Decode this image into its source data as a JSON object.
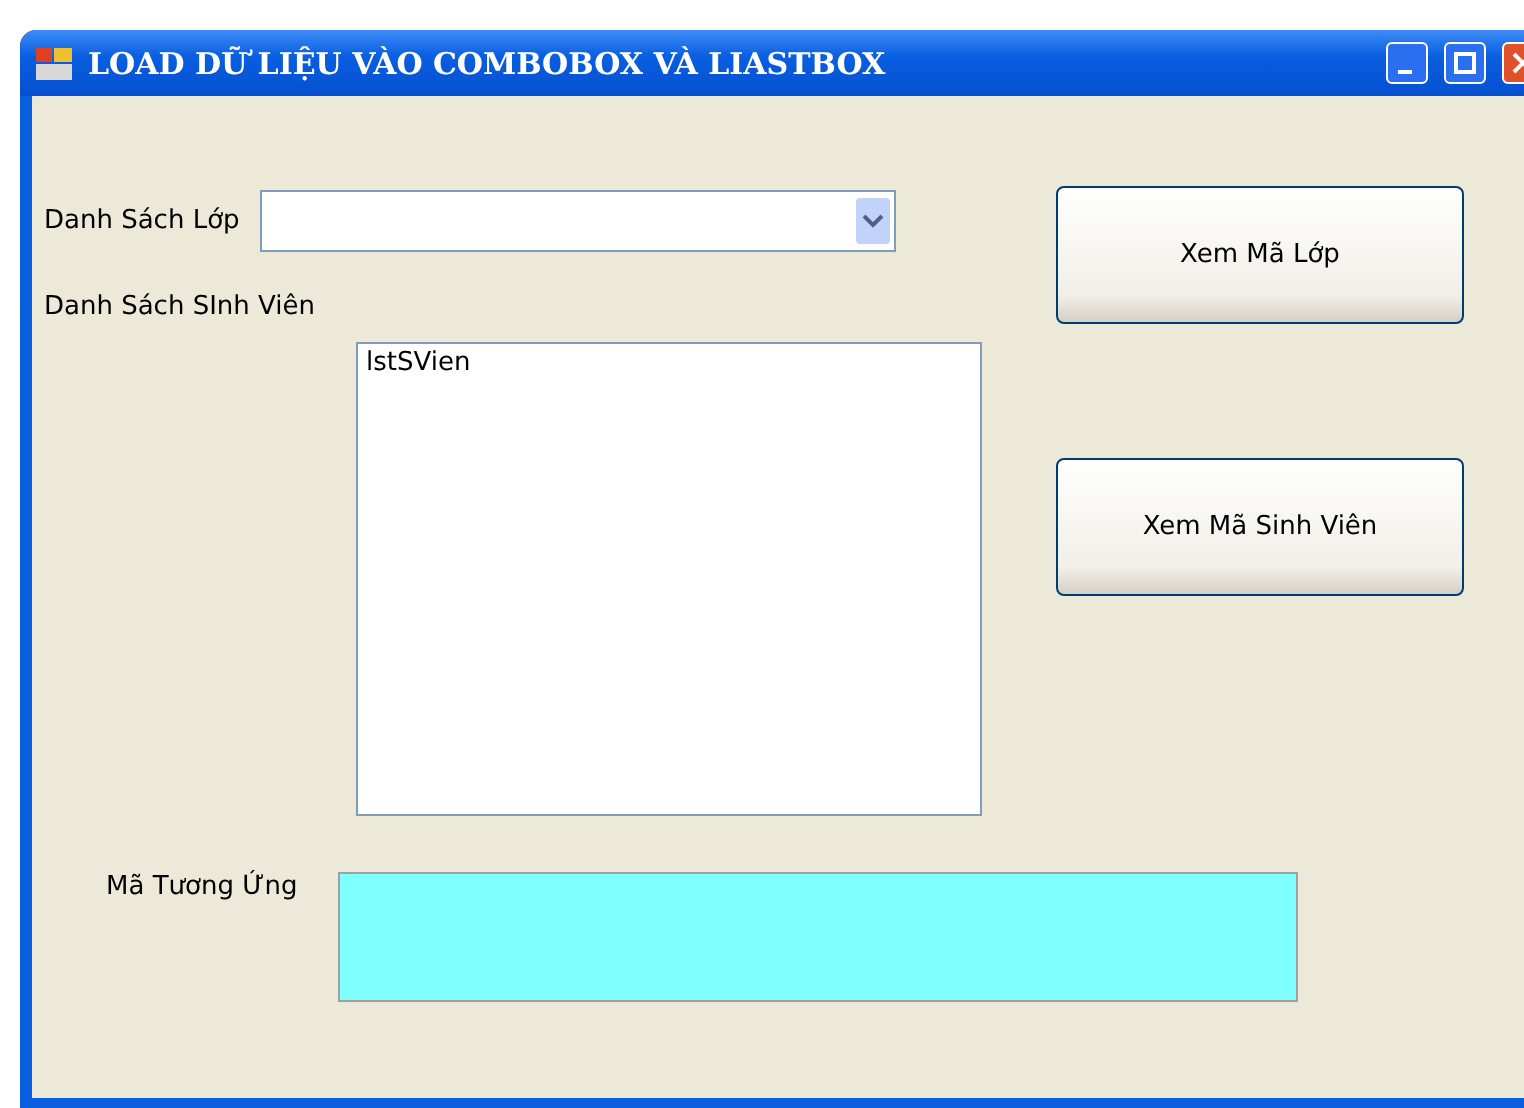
{
  "window": {
    "title": "LOAD DỮ LIỆU VÀO COMBOBOX VÀ LIASTBOX"
  },
  "class_label": "Danh Sách Lớp",
  "student_label": "Danh Sách SInh Viên",
  "student_list": {
    "items": [
      "lstSVien"
    ]
  },
  "buttons": [
    "Xem Mã Lớp",
    "Xem Mã Sinh Viên"
  ],
  "result_label": "Mã Tương Ứng"
}
